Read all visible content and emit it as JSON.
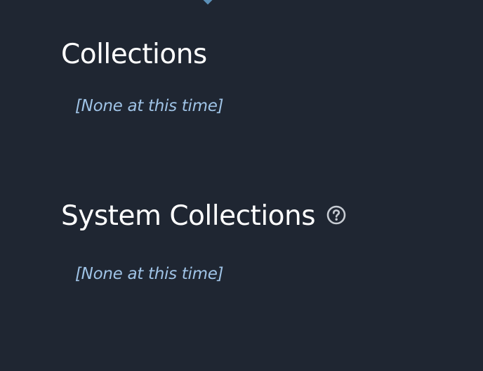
{
  "collections": {
    "title": "Collections",
    "empty_text": "[None at this time]"
  },
  "system_collections": {
    "title": "System Collections",
    "empty_text": "[None at this time]",
    "help_icon": "question-circle-icon"
  },
  "colors": {
    "background": "#1f2632",
    "heading": "#ffffff",
    "empty_text": "#9fc3e6",
    "accent": "#5b90b8",
    "icon": "#c7ccd3"
  }
}
